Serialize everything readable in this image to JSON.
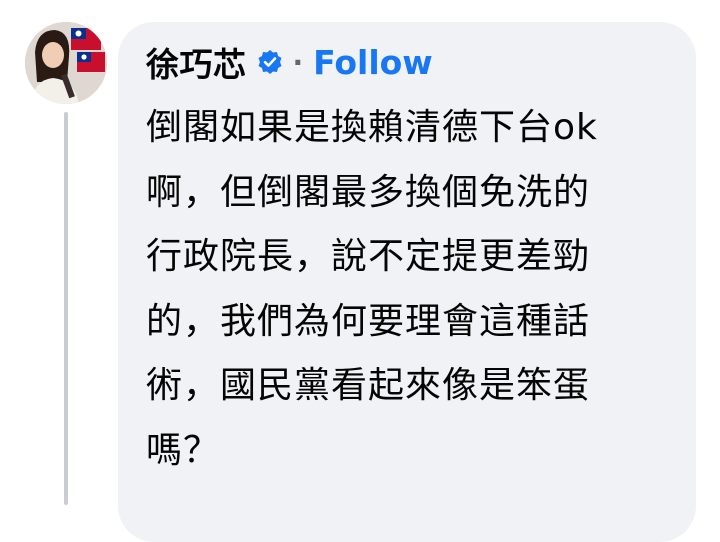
{
  "comment": {
    "author": "徐巧芯",
    "verified_icon": "verified-badge-icon",
    "separator": "·",
    "follow_label": "Follow",
    "text": "倒閣如果是換賴清德下台ok\n啊，但倒閣最多換個免洗的\n行政院長，說不定提更差勁\n的，我們為何要理會這種話\n術，國民黨看起來像是笨蛋\n嗎？"
  },
  "colors": {
    "bubble_bg": "#f0f2f5",
    "follow": "#1877f2",
    "verified": "#1877f2",
    "text": "#050505",
    "thread_line": "#c9ccd1"
  }
}
